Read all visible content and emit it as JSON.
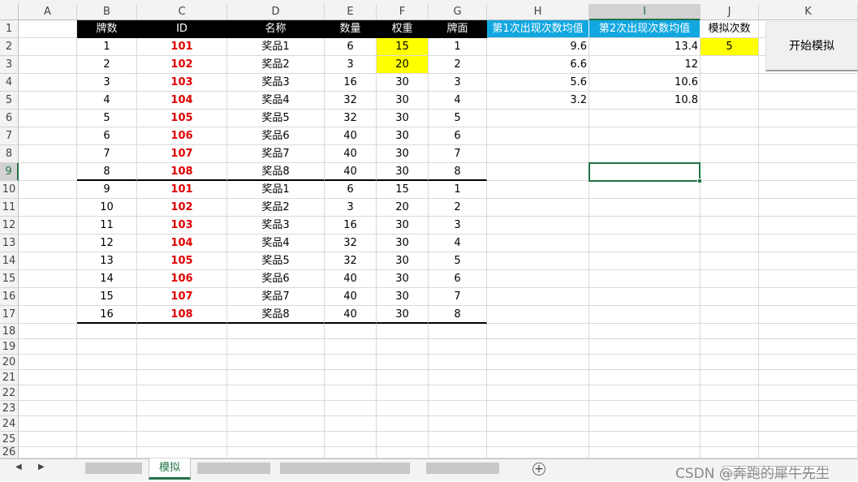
{
  "column_headers": [
    "A",
    "B",
    "C",
    "D",
    "E",
    "F",
    "G",
    "H",
    "I",
    "J",
    "K"
  ],
  "row_headers": [
    "1",
    "2",
    "3",
    "4",
    "5",
    "6",
    "7",
    "8",
    "9",
    "10",
    "11",
    "12",
    "13",
    "14",
    "15",
    "16",
    "17",
    "18",
    "19",
    "20",
    "21",
    "22",
    "23",
    "24",
    "25",
    "26"
  ],
  "table_headers": {
    "pai_shu": "牌数",
    "id": "ID",
    "name": "名称",
    "quantity": "数量",
    "weight": "权重",
    "face": "牌面",
    "avg1": "第1次出现次数均值",
    "avg2": "第2次出现次数均值",
    "sim_count": "模拟次数"
  },
  "sim_count_value": "5",
  "rows": [
    {
      "n": "1",
      "id": "101",
      "name": "奖品1",
      "qty": "6",
      "w": "15",
      "face": "1"
    },
    {
      "n": "2",
      "id": "102",
      "name": "奖品2",
      "qty": "3",
      "w": "20",
      "face": "2"
    },
    {
      "n": "3",
      "id": "103",
      "name": "奖品3",
      "qty": "16",
      "w": "30",
      "face": "3"
    },
    {
      "n": "4",
      "id": "104",
      "name": "奖品4",
      "qty": "32",
      "w": "30",
      "face": "4"
    },
    {
      "n": "5",
      "id": "105",
      "name": "奖品5",
      "qty": "32",
      "w": "30",
      "face": "5"
    },
    {
      "n": "6",
      "id": "106",
      "name": "奖品6",
      "qty": "40",
      "w": "30",
      "face": "6"
    },
    {
      "n": "7",
      "id": "107",
      "name": "奖品7",
      "qty": "40",
      "w": "30",
      "face": "7"
    },
    {
      "n": "8",
      "id": "108",
      "name": "奖品8",
      "qty": "40",
      "w": "30",
      "face": "8"
    },
    {
      "n": "9",
      "id": "101",
      "name": "奖品1",
      "qty": "6",
      "w": "15",
      "face": "1"
    },
    {
      "n": "10",
      "id": "102",
      "name": "奖品2",
      "qty": "3",
      "w": "20",
      "face": "2"
    },
    {
      "n": "11",
      "id": "103",
      "name": "奖品3",
      "qty": "16",
      "w": "30",
      "face": "3"
    },
    {
      "n": "12",
      "id": "104",
      "name": "奖品4",
      "qty": "32",
      "w": "30",
      "face": "4"
    },
    {
      "n": "13",
      "id": "105",
      "name": "奖品5",
      "qty": "32",
      "w": "30",
      "face": "5"
    },
    {
      "n": "14",
      "id": "106",
      "name": "奖品6",
      "qty": "40",
      "w": "30",
      "face": "6"
    },
    {
      "n": "15",
      "id": "107",
      "name": "奖品7",
      "qty": "40",
      "w": "30",
      "face": "7"
    },
    {
      "n": "16",
      "id": "108",
      "name": "奖品8",
      "qty": "40",
      "w": "30",
      "face": "8"
    }
  ],
  "averages": [
    {
      "h": "9.6",
      "i": "13.4"
    },
    {
      "h": "6.6",
      "i": "12"
    },
    {
      "h": "5.6",
      "i": "10.6"
    },
    {
      "h": "3.2",
      "i": "10.8"
    }
  ],
  "button": {
    "label": "开始模拟"
  },
  "sheet_tab": {
    "label": "模拟"
  },
  "add_sheet_symbol": "+",
  "watermark": "CSDN @奔跑的犀牛先生",
  "colors": {
    "accent_green": "#217346",
    "header_blue": "#12a7e0",
    "highlight_yellow": "#ffff00",
    "id_red": "#e00000"
  }
}
